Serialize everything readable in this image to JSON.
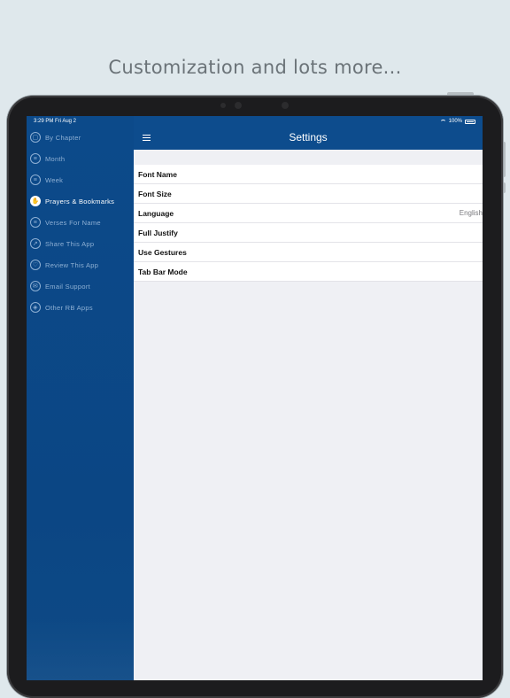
{
  "headline": "Customization and lots more...",
  "status_bar": {
    "time": "3:29 PM  Fri Aug 2",
    "battery": "100%"
  },
  "sidebar": {
    "items": [
      {
        "label": "By Chapter",
        "icon": "book-icon",
        "glyph": "▢",
        "active": false
      },
      {
        "label": "Month",
        "icon": "list-icon",
        "glyph": "≡",
        "active": false
      },
      {
        "label": "Week",
        "icon": "list-icon",
        "glyph": "≡",
        "active": false
      },
      {
        "label": "Prayers & Bookmarks",
        "icon": "praying-hands-icon",
        "glyph": "✋",
        "active": true
      },
      {
        "label": "Verses For Name",
        "icon": "list-icon",
        "glyph": "≡",
        "active": false
      },
      {
        "label": "Share This App",
        "icon": "share-icon",
        "glyph": "↗",
        "active": false
      },
      {
        "label": "Review This App",
        "icon": "thumbs-up-icon",
        "glyph": "♡",
        "active": false
      },
      {
        "label": "Email Support",
        "icon": "email-icon",
        "glyph": "✉",
        "active": false
      },
      {
        "label": "Other RB Apps",
        "icon": "apps-icon",
        "glyph": "◈",
        "active": false
      }
    ]
  },
  "navbar": {
    "title": "Settings"
  },
  "settings": {
    "rows": [
      {
        "label": "Font Name",
        "value": ""
      },
      {
        "label": "Font Size",
        "value": ""
      },
      {
        "label": "Language",
        "value": "English"
      },
      {
        "label": "Full Justify",
        "value": ""
      },
      {
        "label": "Use Gestures",
        "value": ""
      },
      {
        "label": "Tab Bar Mode",
        "value": ""
      }
    ]
  },
  "colors": {
    "sidebar": "#0c4a8a",
    "navbar": "#0d4c8d",
    "background": "#dfe8ec"
  }
}
